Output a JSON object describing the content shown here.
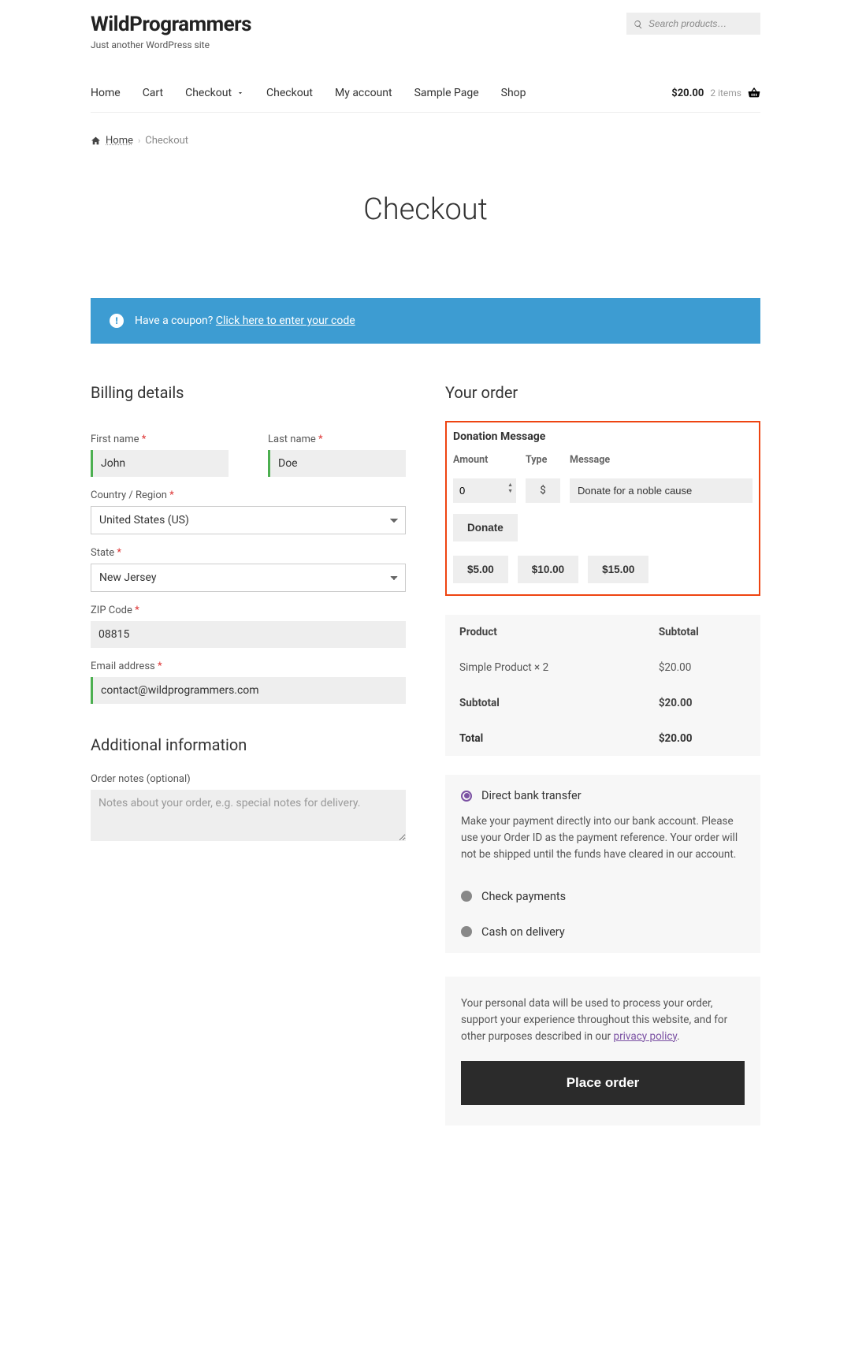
{
  "site": {
    "title": "WildProgrammers",
    "tagline": "Just another WordPress site"
  },
  "search": {
    "placeholder": "Search products…"
  },
  "nav": {
    "items": [
      "Home",
      "Cart",
      "Checkout",
      "Checkout",
      "My account",
      "Sample Page",
      "Shop"
    ],
    "dropdown_index": 2,
    "cart_total": "$20.00",
    "cart_count": "2 items"
  },
  "breadcrumb": {
    "home": "Home",
    "current": "Checkout"
  },
  "page_title": "Checkout",
  "coupon": {
    "prefix": "Have a coupon? ",
    "link": "Click here to enter your code"
  },
  "billing": {
    "heading": "Billing details",
    "first_name": {
      "label": "First name ",
      "value": "John"
    },
    "last_name": {
      "label": "Last name ",
      "value": "Doe"
    },
    "country": {
      "label": "Country / Region ",
      "value": "United States (US)"
    },
    "state": {
      "label": "State ",
      "value": "New Jersey"
    },
    "zip": {
      "label": "ZIP Code ",
      "value": "08815"
    },
    "email": {
      "label": "Email address ",
      "value": "contact@wildprogrammers.com"
    }
  },
  "additional": {
    "heading": "Additional information",
    "notes_label": "Order notes (optional)",
    "notes_placeholder": "Notes about your order, e.g. special notes for delivery."
  },
  "order": {
    "heading": "Your order",
    "donation": {
      "title": "Donation Message",
      "headers": {
        "amount": "Amount",
        "type": "Type",
        "message": "Message"
      },
      "amount": "0",
      "type": "$",
      "message": "Donate for a noble cause",
      "button": "Donate",
      "presets": [
        "$5.00",
        "$10.00",
        "$15.00"
      ]
    },
    "table": {
      "head": {
        "product": "Product",
        "subtotal": "Subtotal"
      },
      "row": {
        "name": "Simple Product  × 2",
        "value": "$20.00"
      },
      "subtotal": {
        "label": "Subtotal",
        "value": "$20.00"
      },
      "total": {
        "label": "Total",
        "value": "$20.00"
      }
    },
    "payment": {
      "bacs": {
        "label": "Direct bank transfer",
        "desc": "Make your payment directly into our bank account. Please use your Order ID as the payment reference. Your order will not be shipped until the funds have cleared in our account."
      },
      "cheque": {
        "label": "Check payments"
      },
      "cod": {
        "label": "Cash on delivery"
      }
    },
    "privacy": {
      "text_prefix": "Your personal data will be used to process your order, support your experience throughout this website, and for other purposes described in our ",
      "link": "privacy policy"
    },
    "place_order": "Place order"
  },
  "required_mark": "*"
}
